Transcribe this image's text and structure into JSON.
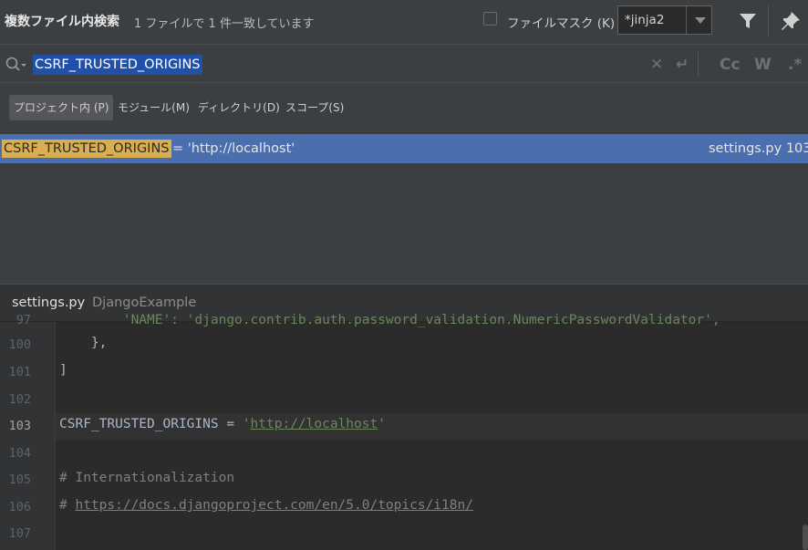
{
  "titlebar": {
    "title": "複数ファイル内検索",
    "summary": "1 ファイルで 1 件一致しています",
    "filemask_label": "ファイルマスク (K)",
    "filemask_checked": false,
    "filemask_value": "*jinja2",
    "icons": [
      "filter-icon",
      "pin-icon"
    ]
  },
  "search": {
    "query": "CSRF_TRUSTED_ORIGINS",
    "icons": [
      "search-history-icon",
      "clear-icon",
      "newline-icon",
      "match-case-icon",
      "whole-words-icon",
      "regex-icon"
    ],
    "match_case_label": "Cc",
    "whole_words_label": "W",
    "regex_label": ".*"
  },
  "scopes": [
    {
      "label": "プロジェクト内 (P)",
      "active": true
    },
    {
      "label": "モジュール(M)",
      "active": false
    },
    {
      "label": "ディレクトリ(D)",
      "active": false
    },
    {
      "label": "スコープ(S)",
      "active": false
    }
  ],
  "results": [
    {
      "match": "CSRF_TRUSTED_ORIGINS",
      "rest": " = 'http://localhost'",
      "location": "settings.py 103"
    }
  ],
  "preview": {
    "file": "settings.py",
    "project": "DjangoExample"
  },
  "editor": {
    "lines": [
      {
        "num": "97",
        "code": "        'NAME': 'django.contrib.auth.password_validation.NumericPasswordValidator',"
      },
      {
        "num": "100",
        "code": "    },"
      },
      {
        "num": "101",
        "code": "]"
      },
      {
        "num": "102",
        "code": ""
      },
      {
        "num": "103",
        "code_name": "CSRF_TRUSTED_ORIGINS",
        "code_eq": " = ",
        "code_q": "'",
        "code_url": "http://localhost"
      },
      {
        "num": "104",
        "code": ""
      },
      {
        "num": "105",
        "code": "# Internationalization"
      },
      {
        "num": "106",
        "code_hash": "# ",
        "code_url": "https://docs.djangoproject.com/en/5.0/topics/i18n/"
      },
      {
        "num": "107",
        "code": ""
      }
    ]
  },
  "colors": {
    "selection": "#4b6eaf",
    "match_highlight": "#d8ae50",
    "panel_bg": "#3c3f41",
    "editor_bg": "#2b2b2b"
  }
}
